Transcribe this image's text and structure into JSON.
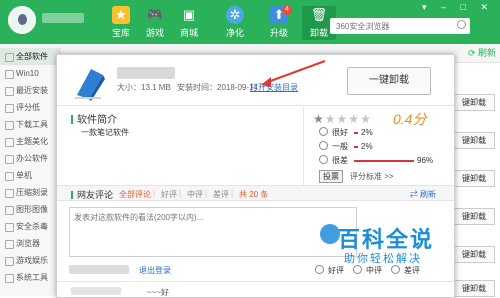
{
  "header": {
    "nav": [
      {
        "label": "宝库",
        "icon": "star-icon"
      },
      {
        "label": "游戏",
        "icon": "gamepad-icon"
      },
      {
        "label": "商城",
        "icon": "store-icon"
      },
      {
        "label": "净化",
        "icon": "gear-icon"
      },
      {
        "label": "升级",
        "icon": "upgrade-icon",
        "badge": "4"
      },
      {
        "label": "卸载",
        "icon": "trash-icon"
      }
    ],
    "search_placeholder": "360安全浏览器",
    "window_controls": "▾ – □ ✕"
  },
  "subbar": {
    "refresh": "刷新"
  },
  "sidebar": {
    "items": [
      "全部软件",
      "Win10",
      "最近安装",
      "评分低",
      "下载工具",
      "主题美化",
      "办公软件",
      "单机",
      "压缩刻录",
      "图形图像",
      "安全杀毒",
      "浏览器",
      "游戏娱乐",
      "系统工具"
    ]
  },
  "background_buttons": {
    "label": "键卸载"
  },
  "dialog": {
    "size_text": "大小：13.1 MB",
    "install_time": "安装时间：2018-09-14",
    "open_dir": "打开安装目录",
    "uninstall_btn": "一键卸载",
    "intro_title": "软件简介",
    "intro_text": "一款笔记软件",
    "score": "0.4分",
    "stars_on": 1,
    "ratings": [
      {
        "label": "很好",
        "pct": "2%",
        "value": 2
      },
      {
        "label": "一般",
        "pct": "2%",
        "value": 2
      },
      {
        "label": "很差",
        "pct": "96%",
        "value": 96
      }
    ],
    "vote_btn": "投票",
    "rating_standard": "评分标准 >>",
    "comments": {
      "title": "网友评论",
      "tabs": [
        "全部评论",
        "好评",
        "中评",
        "差评"
      ],
      "count": "共 20 条",
      "refresh": "刷新",
      "placeholder": "发表对这款软件的看法(200字以内)...",
      "logout": "退出登录",
      "options": [
        "好评",
        "中评",
        "差评"
      ],
      "tail_text": "~~~好"
    }
  },
  "watermark": {
    "title": "百科全说",
    "subtitle": "助你轻松解决"
  },
  "colors": {
    "brand_green": "#2bb15a",
    "link_blue": "#2a72c8",
    "score_orange": "#f08c18",
    "bad_red": "#d9363e"
  }
}
